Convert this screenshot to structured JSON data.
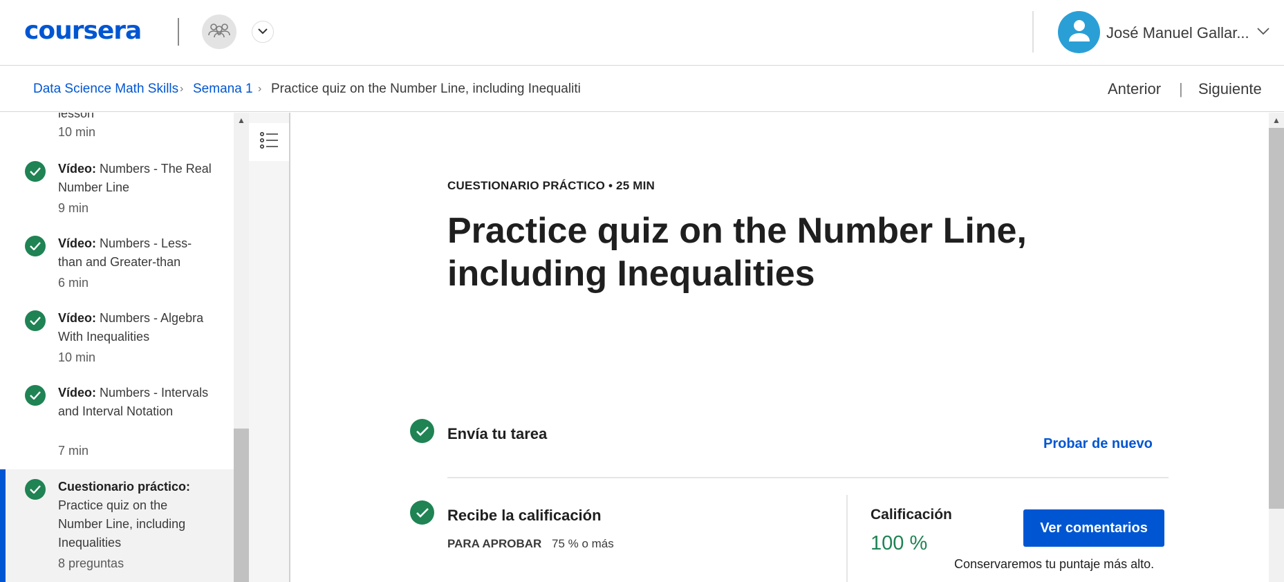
{
  "header": {
    "logo": "coursera",
    "user_name": "José Manuel Gallar..."
  },
  "breadcrumb": {
    "items": [
      "Data Science Math Skills",
      "Semana 1",
      "Practice quiz on the Number Line, including Inequaliti"
    ],
    "separator": "›",
    "prev": "Anterior",
    "nav_separator": "|",
    "next": "Siguiente"
  },
  "sidebar": {
    "partial_item": {
      "text": "lesson",
      "duration": "10 min"
    },
    "items": [
      {
        "type": "Vídeo:",
        "title": "Numbers - The Real Number Line",
        "duration": "9 min"
      },
      {
        "type": "Vídeo:",
        "title": "Numbers - Less-than and Greater-than",
        "duration": "6 min"
      },
      {
        "type": "Vídeo:",
        "title": "Numbers - Algebra With Inequalities",
        "duration": "10 min"
      },
      {
        "type": "Vídeo:",
        "title": "Numbers - Intervals and Interval Notation",
        "duration": "7 min"
      },
      {
        "type": "Cuestionario práctico:",
        "title": "Practice quiz on the Number Line, including Inequalities",
        "duration": "8 preguntas"
      }
    ]
  },
  "main": {
    "kicker": "CUESTIONARIO PRÁCTICO • 25 MIN",
    "title": "Practice quiz on the Number Line, including Inequalities",
    "submit_step": "Envía tu tarea",
    "retry_link": "Probar de nuevo",
    "grade_step": "Recibe la calificación",
    "pass_label": "PARA APROBAR",
    "pass_value": "75 % o más",
    "grade_label": "Calificación",
    "grade_value": "100 %",
    "feedback_button": "Ver comentarios",
    "keep_note": "Conservaremos tu puntaje más alto."
  },
  "colors": {
    "brand": "#0056d2",
    "success": "#1f8354"
  }
}
